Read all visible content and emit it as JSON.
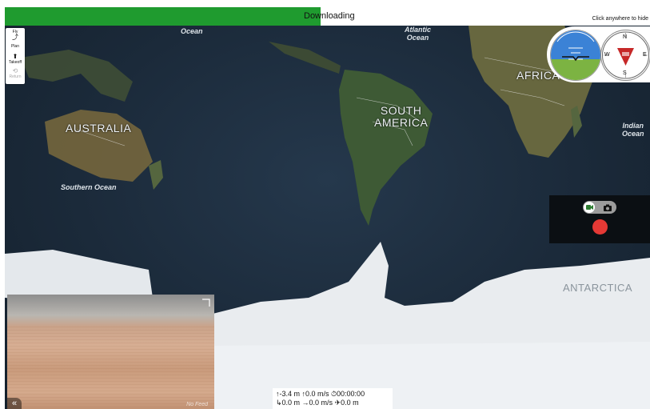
{
  "header": {
    "progress_label": "Downloading",
    "progress_fraction": 0.49,
    "progress_color": "#1f9b2f",
    "hint": "Click anywhere to hide"
  },
  "toolstrip": {
    "items": [
      {
        "label": "Fly",
        "icon": "fly-icon",
        "enabled": true
      },
      {
        "label": "Plan",
        "icon": "route-icon",
        "enabled": true
      },
      {
        "label": "Takeoff",
        "icon": "takeoff-icon",
        "enabled": true
      },
      {
        "label": "Return",
        "icon": "return-icon",
        "enabled": false
      }
    ]
  },
  "map": {
    "labels": {
      "ocean_top_left": "Ocean",
      "atlantic": "Atlantic\nOcean",
      "australia": "AUSTRALIA",
      "south_america": "SOUTH\nAMERICA",
      "africa": "AFRICA",
      "indian_ocean": "Indian\nOcean",
      "southern_ocean": "Southern Ocean",
      "antarctica": "ANTARCTICA"
    }
  },
  "compass": {
    "n": "N",
    "s": "S",
    "e": "E",
    "w": "W"
  },
  "camera": {
    "mode": "video",
    "video_icon": "video-camera-icon",
    "photo_icon": "photo-camera-icon",
    "record_color": "#e53935"
  },
  "video": {
    "watermark": "No Feed"
  },
  "telemetry": {
    "line1": "↑-3.4 m  ↑0.0 m/s  ⏱00:00:00",
    "line2": "↳0.0 m  →0.0 m/s  ✈0.0 m"
  },
  "colors": {
    "ocean": "#1b2a3a",
    "land": "#4a5a3e",
    "ice": "#e9ecef",
    "sky": "#3b82d6",
    "ground": "#7cb342",
    "compass_arrow": "#c62828"
  }
}
